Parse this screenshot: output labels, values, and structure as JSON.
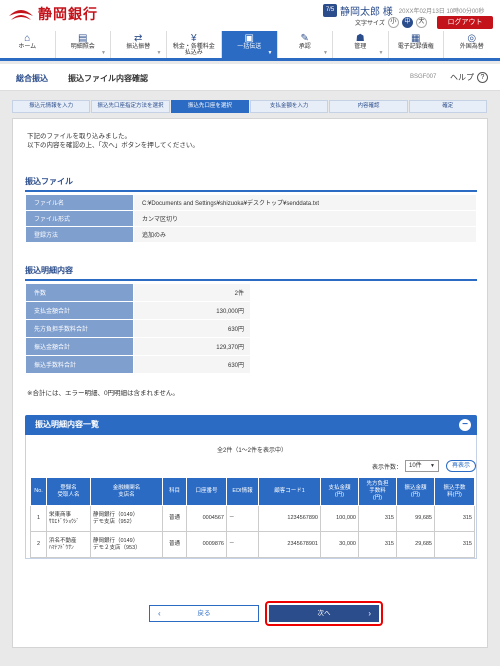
{
  "header": {
    "bank_name": "静岡銀行",
    "user_badge": "7/5",
    "user_name": "静岡太郎 様",
    "datetime": "20XX年02月13日 10時00分00秒",
    "font_size_label": "文字サイズ",
    "font_sizes": [
      "小",
      "中",
      "大"
    ],
    "logout": "ログアウト"
  },
  "nav": [
    {
      "label": "ホーム",
      "icon": "home-icon"
    },
    {
      "label": "明細照会",
      "icon": "document-icon"
    },
    {
      "label": "振込振替",
      "icon": "transfer-icon"
    },
    {
      "label": "税金・各種料金\n払込み",
      "icon": "tax-icon"
    },
    {
      "label": "一括伝送",
      "icon": "batch-icon"
    },
    {
      "label": "承認",
      "icon": "approve-icon"
    },
    {
      "label": "管理",
      "icon": "admin-icon"
    },
    {
      "label": "電子記録債権",
      "icon": "bond-icon"
    },
    {
      "label": "外国為替",
      "icon": "forex-icon"
    }
  ],
  "title": {
    "category": "総合振込",
    "page": "振込ファイル内容確認",
    "screen_id": "BSGF007",
    "help": "ヘルプ"
  },
  "steps": [
    "振込元情報を入力",
    "振込先口座指定方法を選択",
    "振込先口座を選択",
    "支払金額を入力",
    "内容確認",
    "確定"
  ],
  "message": [
    "下記のファイルを取り込みました。",
    "以下の内容を確認の上、「次へ」ボタンを押してください。"
  ],
  "file_section": {
    "heading": "振込ファイル",
    "rows": [
      {
        "k": "ファイル名",
        "v": "C:¥Documents and Settings¥shizuoka¥デスクトップ¥senddata.txt"
      },
      {
        "k": "ファイル形式",
        "v": "カンマ区切り"
      },
      {
        "k": "登録方法",
        "v": "追加のみ"
      }
    ]
  },
  "summary_section": {
    "heading": "振込明細内容",
    "rows": [
      {
        "k": "件数",
        "v": "2件"
      },
      {
        "k": "支払金額合計",
        "v": "130,000円"
      },
      {
        "k": "先方負担手数料合計",
        "v": "630円"
      },
      {
        "k": "振込金額合計",
        "v": "129,370円"
      },
      {
        "k": "振込手数料合計",
        "v": "630円"
      }
    ],
    "note": "※合計には、エラー明細、0円明細は含まれません。"
  },
  "list": {
    "heading": "振込明細内容一覧",
    "count": "全2件（1～2件を表示中）",
    "per_page_label": "表示件数：",
    "per_page": "10件",
    "redisplay": "再表示",
    "columns": [
      "No.",
      "登録名\n受取人名",
      "金融機関名\n支店名",
      "科目",
      "口座番号",
      "EDI情報",
      "顧客コード1",
      "支払金額\n(円)",
      "先方負担\n手数料\n(円)",
      "振込金額\n(円)",
      "振込手数\n料(円)"
    ],
    "rows": [
      {
        "no": "1",
        "name": "栄東商事\nｻｶｴﾄﾞｳｼｮｳｼﾞ",
        "bank": "静岡銀行（0149）\nデモ支店（952）",
        "type": "普通",
        "account": "0004567",
        "edi": "－",
        "code": "1234567890",
        "amount": "100,000",
        "bearer": "315",
        "transfer": "99,685",
        "fee": "315"
      },
      {
        "no": "2",
        "name": "浜名不動産\nﾊﾏﾅﾌﾄﾞｳｻﾝ",
        "bank": "静岡銀行（0149）\nデモ２支店（953）",
        "type": "普通",
        "account": "0009876",
        "edi": "－",
        "code": "2345678901",
        "amount": "30,000",
        "bearer": "315",
        "transfer": "29,685",
        "fee": "315"
      }
    ]
  },
  "buttons": {
    "back": "戻る",
    "next": "次へ"
  }
}
